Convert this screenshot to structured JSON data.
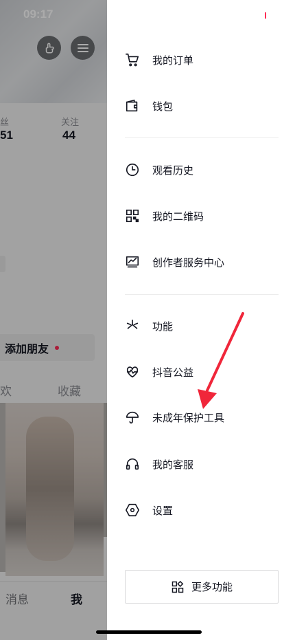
{
  "status_bar": {
    "time": "09:17"
  },
  "profile_background": {
    "stats": [
      {
        "label": "丝",
        "value": "51"
      },
      {
        "label": "关注",
        "value": "44"
      }
    ],
    "add_friend_label": "添加朋友",
    "tabs": [
      "欢",
      "收藏"
    ],
    "bottom_nav": [
      "消息",
      "我"
    ]
  },
  "drawer": {
    "menu": [
      {
        "label": "我的订单",
        "icon": "cart-icon"
      },
      {
        "label": "钱包",
        "icon": "wallet-icon"
      },
      {
        "label": "观看历史",
        "icon": "clock-icon"
      },
      {
        "label": "我的二维码",
        "icon": "qr-code-icon"
      },
      {
        "label": "创作者服务中心",
        "icon": "chart-monitor-icon"
      },
      {
        "label": "功能",
        "icon": "sparkle-icon"
      },
      {
        "label": "抖音公益",
        "icon": "heart-pulse-icon"
      },
      {
        "label": "未成年保护工具",
        "icon": "umbrella-icon"
      },
      {
        "label": "我的客服",
        "icon": "headset-icon"
      },
      {
        "label": "设置",
        "icon": "settings-hexagon-icon"
      }
    ],
    "more_button_label": "更多功能"
  },
  "colors": {
    "accent": "#fe2c55",
    "annotation_arrow": "#f0263a"
  }
}
